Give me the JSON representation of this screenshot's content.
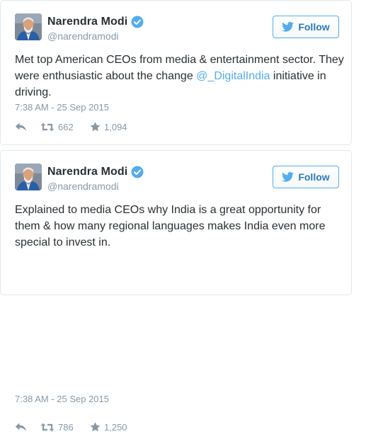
{
  "tweets": [
    {
      "display_name": "Narendra Modi",
      "handle": "@narendramodi",
      "follow_label": "Follow",
      "text_before": "Met top American CEOs from media & entertainment sector. They were enthusiastic about the change ",
      "mention": "@_DigitalIndia",
      "text_after": " initiative in driving.",
      "timestamp": "7:38 AM - 25 Sep 2015",
      "retweets": "662",
      "favorites": "1,094"
    },
    {
      "display_name": "Narendra Modi",
      "handle": "@narendramodi",
      "follow_label": "Follow",
      "text": "Explained to media CEOs why India is a great opportunity for them & how many regional languages makes India even more special to invest in.",
      "timestamp": "7:38 AM - 25 Sep 2015",
      "retweets": "786",
      "favorites": "1,250"
    }
  ],
  "icons": {
    "verified": "verified-badge-icon",
    "bird": "twitter-bird-icon",
    "reply": "reply-arrow-icon",
    "retweet": "retweet-icon",
    "favorite": "star-icon"
  },
  "colors": {
    "accent": "#55acee",
    "follow_text": "#2b7bb9",
    "secondary_text": "#8899a6",
    "primary_text": "#292f33",
    "border": "#e1e8ed"
  }
}
